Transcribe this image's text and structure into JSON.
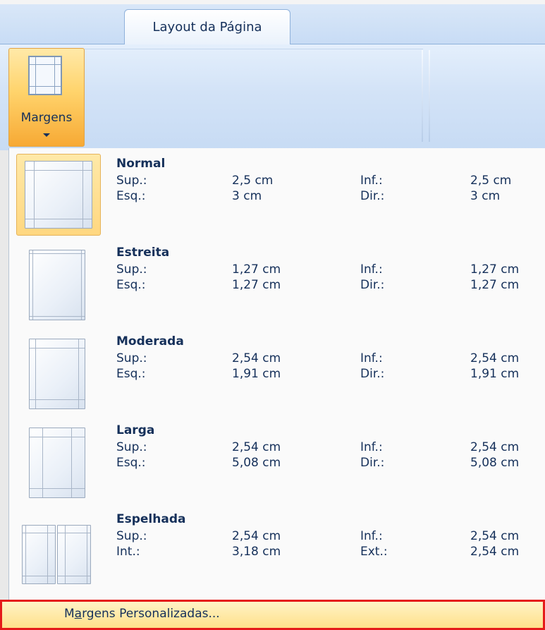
{
  "ribbon": {
    "active_tab": "Layout da Página",
    "margins_button_label": "Margens"
  },
  "menu": {
    "items": [
      {
        "name": "Normal",
        "l1": "Sup.:",
        "v1": "2,5 cm",
        "l2": "Inf.:",
        "v2": "2,5 cm",
        "l3": "Esq.:",
        "v3": "3 cm",
        "l4": "Dir.:",
        "v4": "3 cm"
      },
      {
        "name": "Estreita",
        "l1": "Sup.:",
        "v1": "1,27 cm",
        "l2": "Inf.:",
        "v2": "1,27 cm",
        "l3": "Esq.:",
        "v3": "1,27 cm",
        "l4": "Dir.:",
        "v4": "1,27 cm"
      },
      {
        "name": "Moderada",
        "l1": "Sup.:",
        "v1": "2,54 cm",
        "l2": "Inf.:",
        "v2": "2,54 cm",
        "l3": "Esq.:",
        "v3": "1,91 cm",
        "l4": "Dir.:",
        "v4": "1,91 cm"
      },
      {
        "name": "Larga",
        "l1": "Sup.:",
        "v1": "2,54 cm",
        "l2": "Inf.:",
        "v2": "2,54 cm",
        "l3": "Esq.:",
        "v3": "5,08 cm",
        "l4": "Dir.:",
        "v4": "5,08 cm"
      },
      {
        "name": "Espelhada",
        "l1": "Sup.:",
        "v1": "2,54 cm",
        "l2": "Inf.:",
        "v2": "2,54 cm",
        "l3": "Int.:",
        "v3": "3,18 cm",
        "l4": "Ext.:",
        "v4": "2,54 cm"
      }
    ],
    "custom_margins": {
      "label": "Margens Personalizadas...",
      "access_key": "a"
    }
  },
  "colors": {
    "highlight": "#ffd780",
    "callout_border": "#e51a1a",
    "text": "#15305a"
  }
}
